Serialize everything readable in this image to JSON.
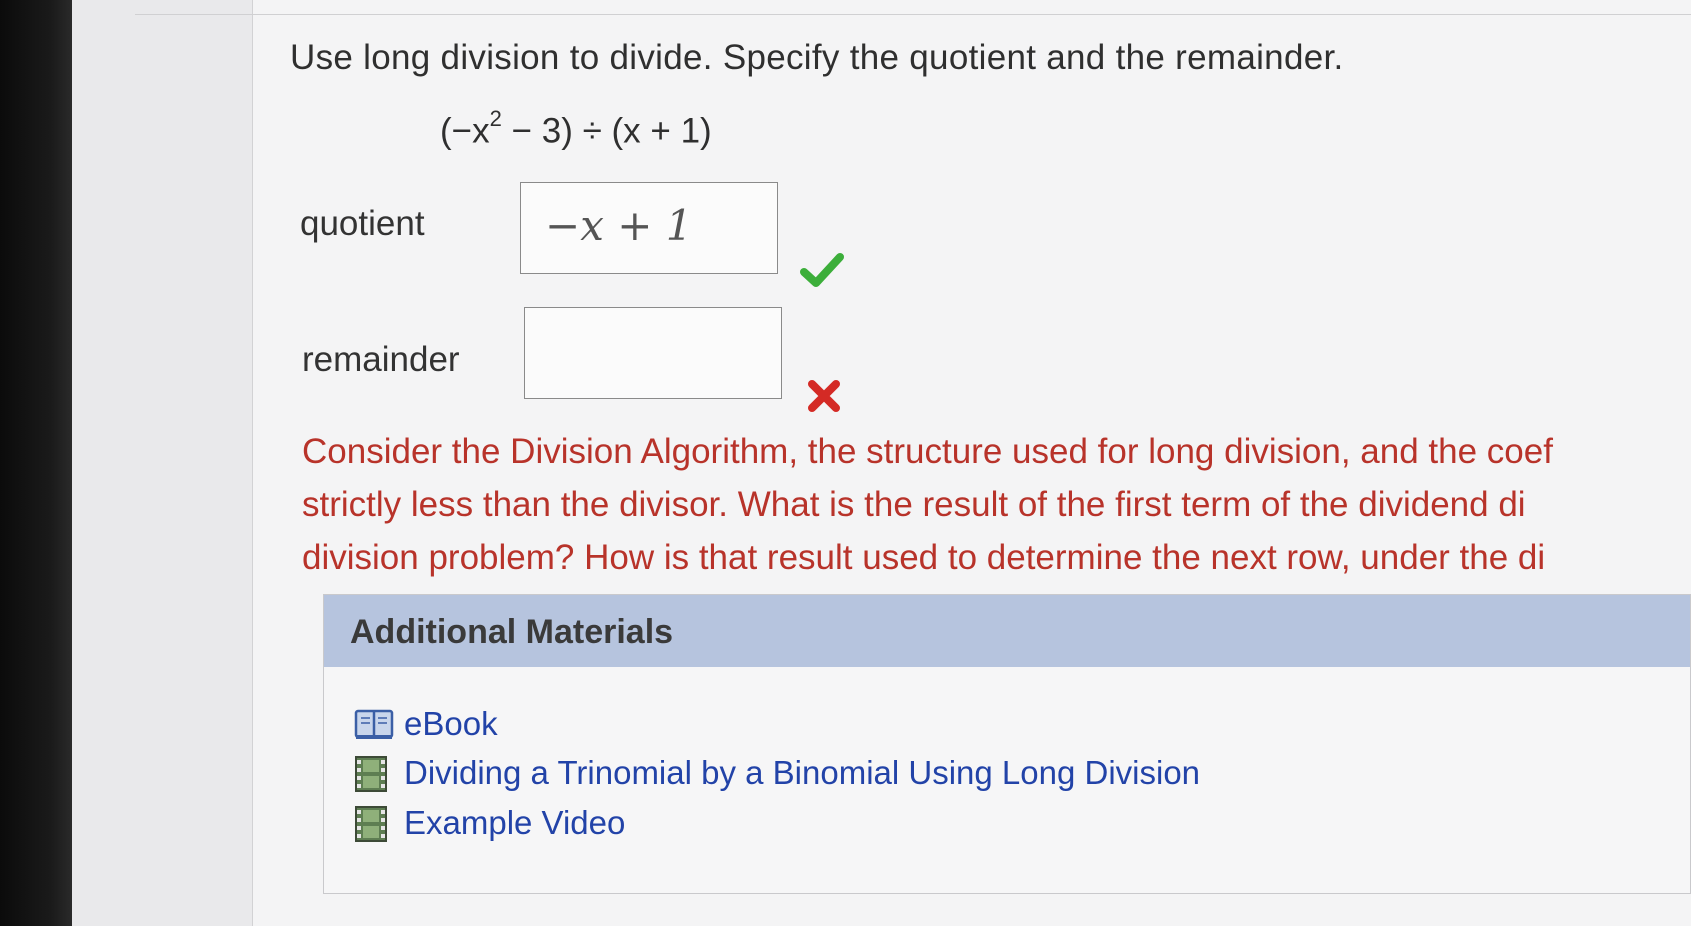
{
  "question": {
    "prompt": "Use long division to divide. Specify the quotient and the remainder.",
    "expression_part1": "(−x",
    "expression_exp": "2",
    "expression_part2": " − 3) ÷ (x + 1)"
  },
  "fields": {
    "quotient": {
      "label": "quotient",
      "value": "−x + 1",
      "status": "correct"
    },
    "remainder": {
      "label": "remainder",
      "value": "",
      "status": "incorrect"
    }
  },
  "hint": {
    "lines": [
      "Consider the Division Algorithm, the structure used for long division, and the coef",
      "strictly less than the divisor. What is the result of the first term of the dividend di",
      "division problem? How is that result used to determine the next row, under the di"
    ]
  },
  "additional_materials": {
    "title": "Additional Materials",
    "items": [
      {
        "label": "eBook",
        "icon": "book-icon"
      },
      {
        "label": "Dividing a Trinomial by a Binomial Using Long Division",
        "icon": "film-icon"
      },
      {
        "label": "Example Video",
        "icon": "film-icon"
      }
    ]
  },
  "colors": {
    "correct": "#3cae3a",
    "incorrect": "#d42a25",
    "hint_text": "#b8332a",
    "link": "#2243a8",
    "materials_header": "#b6c4de"
  }
}
